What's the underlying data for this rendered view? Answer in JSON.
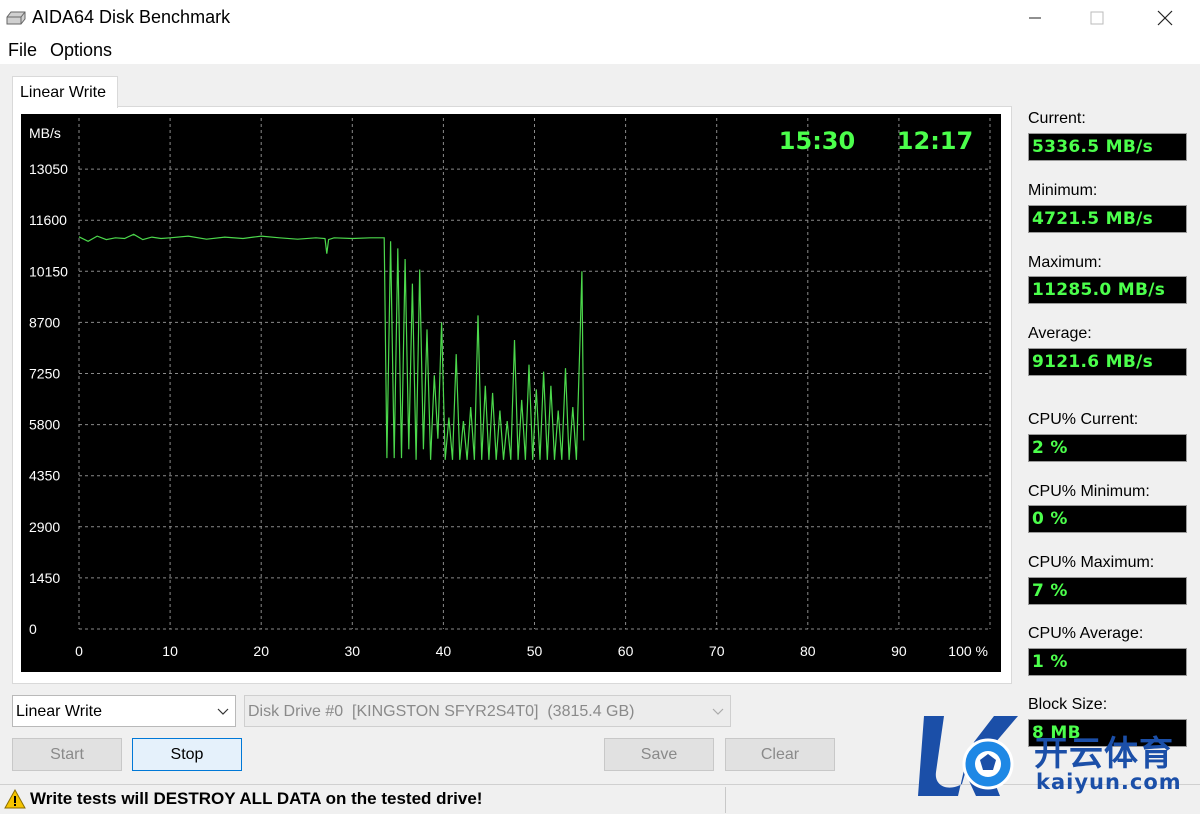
{
  "window": {
    "title": "AIDA64 Disk Benchmark",
    "icon": "disk-drive-icon"
  },
  "menu": {
    "file": "File",
    "options": "Options"
  },
  "tab": {
    "label": "Linear Write"
  },
  "chart_data": {
    "type": "line",
    "ylabel": "MB/s",
    "xlabel": "",
    "yticks": [
      "13050",
      "11600",
      "10150",
      "8700",
      "7250",
      "5800",
      "4350",
      "2900",
      "1450",
      "0"
    ],
    "xticks": [
      "0",
      "10",
      "20",
      "30",
      "40",
      "50",
      "60",
      "70",
      "80",
      "90",
      "100 %"
    ],
    "ylim": [
      0,
      14500
    ],
    "xlim": [
      0,
      100
    ],
    "grid": true,
    "line_color": "#4cd84c",
    "timers": [
      "15:30",
      "12:17"
    ],
    "series": [
      {
        "x": [
          0,
          1,
          2,
          3,
          4,
          5,
          6,
          7,
          8,
          9,
          10,
          12,
          14,
          16,
          18,
          20,
          22,
          24,
          26,
          27,
          27.2,
          27.4,
          28,
          30,
          32,
          33.5,
          33.8,
          34.2,
          34.6,
          35,
          35.4,
          35.8,
          36.2,
          36.6,
          37,
          37.4,
          37.8,
          38.2,
          38.6,
          39,
          39.4,
          39.8,
          40.2,
          40.6,
          41,
          41.4,
          41.8,
          42.2,
          42.6,
          43,
          43.4,
          43.8,
          44.2,
          44.6,
          45,
          45.4,
          45.8,
          46.2,
          46.6,
          47,
          47.4,
          47.8,
          48.2,
          48.6,
          49,
          49.4,
          49.8,
          50.2,
          50.6,
          51,
          51.4,
          51.8,
          52.2,
          52.6,
          53,
          53.4,
          53.8,
          54.2,
          54.6,
          55,
          55.2,
          55.4
        ],
        "y": [
          11130,
          11000,
          11150,
          11050,
          11100,
          11080,
          11200,
          11050,
          11120,
          11080,
          11100,
          11150,
          11060,
          11120,
          11080,
          11150,
          11100,
          11060,
          11100,
          11080,
          10650,
          11050,
          11100,
          11080,
          11100,
          11100,
          4850,
          11000,
          4850,
          10800,
          4850,
          10500,
          5100,
          9800,
          4800,
          10200,
          5100,
          8500,
          4800,
          7200,
          5400,
          8700,
          4800,
          6000,
          4800,
          7800,
          4800,
          5900,
          4800,
          6300,
          4800,
          8900,
          4800,
          6900,
          4800,
          6700,
          4800,
          6200,
          4800,
          5900,
          4800,
          8200,
          4800,
          6500,
          4800,
          7500,
          4800,
          6800,
          4800,
          7300,
          4800,
          6900,
          4800,
          6200,
          4800,
          7400,
          4800,
          6300,
          4800,
          8300,
          10150,
          5350
        ]
      }
    ]
  },
  "stats": {
    "current_label": "Current:",
    "current_value": "5336.5 MB/s",
    "minimum_label": "Minimum:",
    "minimum_value": "4721.5 MB/s",
    "maximum_label": "Maximum:",
    "maximum_value": "11285.0 MB/s",
    "average_label": "Average:",
    "average_value": "9121.6 MB/s",
    "cpu_current_label": "CPU% Current:",
    "cpu_current_value": "2 %",
    "cpu_minimum_label": "CPU% Minimum:",
    "cpu_minimum_value": "0 %",
    "cpu_maximum_label": "CPU% Maximum:",
    "cpu_maximum_value": "7 %",
    "cpu_average_label": "CPU% Average:",
    "cpu_average_value": "1 %",
    "block_size_label": "Block Size:",
    "block_size_value": "8 MB"
  },
  "controls": {
    "test_select": "Linear Write",
    "drive_select": "Disk Drive #0  [KINGSTON SFYR2S4T0]  (3815.4 GB)",
    "start": "Start",
    "stop": "Stop",
    "save": "Save",
    "clear": "Clear"
  },
  "status": {
    "warning": "Write tests will DESTROY ALL DATA on the tested drive!"
  },
  "watermark": {
    "text": "开云体育",
    "sub": "kaiyun.com"
  },
  "colors": {
    "chart_background": "#000000",
    "chart_line": "#4cd84c",
    "value_text": "#4cff4c",
    "watermark": "#1b4fa8"
  }
}
